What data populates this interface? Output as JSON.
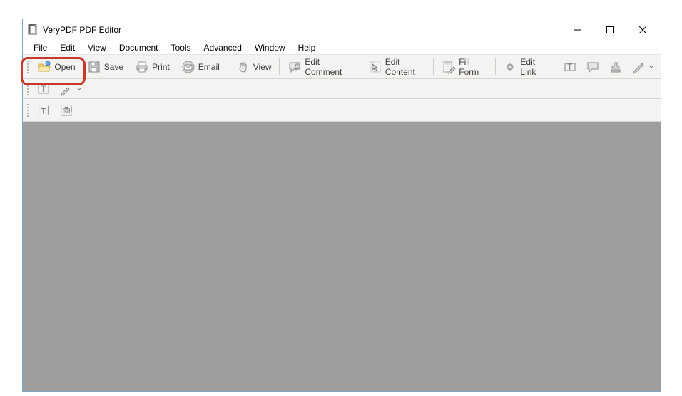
{
  "window": {
    "title": "VeryPDF PDF Editor"
  },
  "menu": {
    "items": [
      "File",
      "Edit",
      "View",
      "Document",
      "Tools",
      "Advanced",
      "Window",
      "Help"
    ]
  },
  "toolbar": {
    "open": "Open",
    "save": "Save",
    "print": "Print",
    "email": "Email",
    "view": "View",
    "edit_comment": "Edit Comment",
    "edit_content": "Edit Content",
    "fill_form": "Fill Form",
    "edit_link": "Edit Link"
  }
}
